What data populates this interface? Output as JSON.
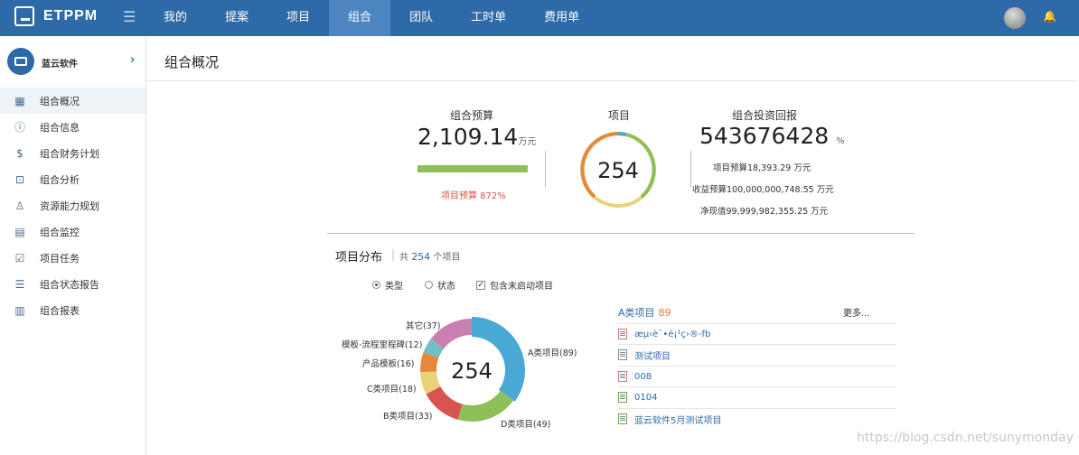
{
  "app": {
    "name": "ETPPM"
  },
  "nav": {
    "items": [
      "我的",
      "提案",
      "项目",
      "组合",
      "团队",
      "工时单",
      "费用单"
    ],
    "active": "组合"
  },
  "sidebar": {
    "org_name": "蓝云软件",
    "items": [
      {
        "label": "组合概况",
        "icon": "grid-icon",
        "active": true
      },
      {
        "label": "组合信息",
        "icon": "info-icon"
      },
      {
        "label": "组合财务计划",
        "icon": "finance-icon"
      },
      {
        "label": "组合分析",
        "icon": "analysis-icon"
      },
      {
        "label": "资源能力规划",
        "icon": "resource-icon"
      },
      {
        "label": "组合监控",
        "icon": "monitor-icon"
      },
      {
        "label": "项目任务",
        "icon": "task-icon"
      },
      {
        "label": "组合状态报告",
        "icon": "report-icon"
      },
      {
        "label": "组合报表",
        "icon": "chart-icon"
      }
    ]
  },
  "page": {
    "title": "组合概况"
  },
  "budget": {
    "label": "组合预算",
    "value": "2,109.14",
    "unit": "万元",
    "pct_text": "项目预算 872%"
  },
  "projects": {
    "label": "项目",
    "count": "254"
  },
  "roi": {
    "label": "组合投资回报",
    "value": "543676428",
    "unit": "%",
    "lines": [
      "项目预算18,393.29 万元",
      "收益预算100,000,000,748.55 万元",
      "净现值99,999,982,355.25 万元"
    ]
  },
  "distribution": {
    "title": "项目分布",
    "sep": "|",
    "count_prefix": "共",
    "count": "254",
    "count_suffix": "个项目",
    "options": {
      "type": "类型",
      "status": "状态",
      "include": "包含未启动项目"
    },
    "colors": [
      "#4aa9d4",
      "#8fbf59",
      "#d9534f",
      "#e8d27a",
      "#e6883a",
      "#6fc1c6",
      "#c97fb0"
    ]
  },
  "chart_data": {
    "type": "pie",
    "center_text": "254",
    "categories": [
      "A类项目",
      "D类项目",
      "B类项目",
      "C类项目",
      "产品模板",
      "模板-流程里程碑",
      "其它"
    ],
    "values": [
      89,
      49,
      33,
      18,
      16,
      12,
      37
    ],
    "labels": [
      "A类项目(89)",
      "D类项目(49)",
      "B类项目(33)",
      "C类项目(18)",
      "产品模板(16)",
      "模板-流程里程碑(12)",
      "其它(37)"
    ]
  },
  "project_list": {
    "title": "A类项目",
    "count": "89",
    "more": "更多...",
    "items": [
      {
        "name": "æµ‹è¯•é¡¹ç›®-fb",
        "icon": "project-stopped-icon"
      },
      {
        "name": "测试项目",
        "icon": "project-doc-icon"
      },
      {
        "name": "008",
        "icon": "project-stopped-icon"
      },
      {
        "name": "0104",
        "icon": "project-active-icon"
      },
      {
        "name": "蓝云软件5月测试项目",
        "icon": "project-active-icon"
      }
    ]
  },
  "watermark": "https://blog.csdn.net/sunymonday"
}
